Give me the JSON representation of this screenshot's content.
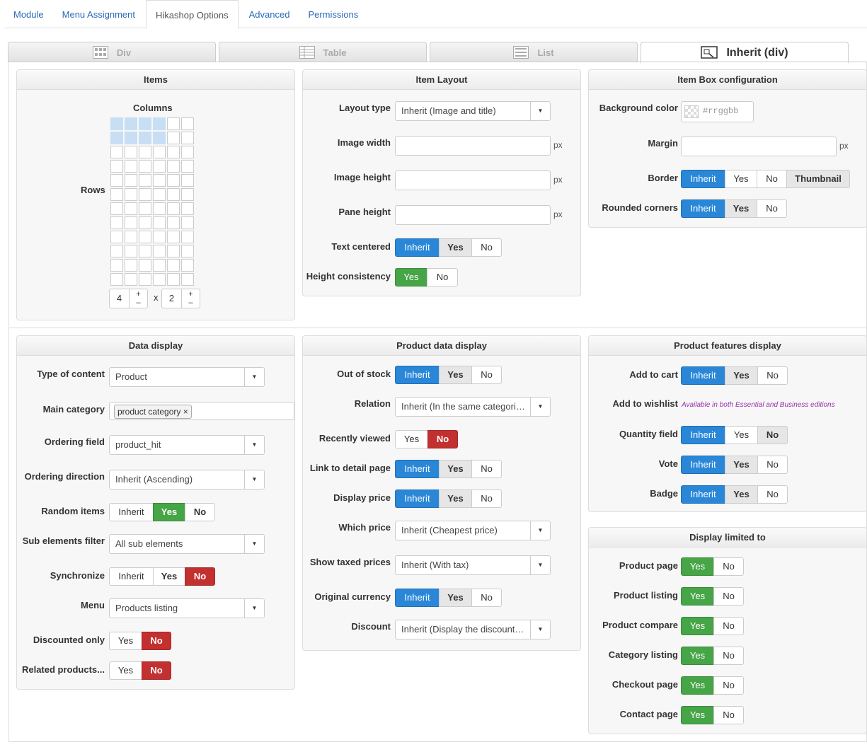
{
  "tabs": [
    "Module",
    "Menu Assignment",
    "Hikashop Options",
    "Advanced",
    "Permissions"
  ],
  "view_tabs": [
    "Div",
    "Table",
    "List",
    "Inherit (div)"
  ],
  "items": {
    "title": "Items",
    "columns_label": "Columns",
    "rows_label": "Rows",
    "columns_value": "4",
    "rows_value": "2",
    "times": "x",
    "plus": "+",
    "minus": "–"
  },
  "item_layout": {
    "title": "Item Layout",
    "layout_type_label": "Layout type",
    "layout_type": "Inherit (Image and title)",
    "image_width_label": "Image width",
    "image_height_label": "Image height",
    "pane_height_label": "Pane height",
    "px": "px",
    "text_centered_label": "Text centered",
    "height_consistency_label": "Height consistency"
  },
  "item_box": {
    "title": "Item Box configuration",
    "bg_color_label": "Background color",
    "bg_color_placeholder": "#rrggbb",
    "margin_label": "Margin",
    "border_label": "Border",
    "rounded_label": "Rounded corners"
  },
  "data_display": {
    "title": "Data display",
    "type_label": "Type of content",
    "type_value": "Product",
    "main_cat_label": "Main category",
    "main_cat_tag": "product category",
    "tag_remove": "×",
    "ordering_field_label": "Ordering field",
    "ordering_field": "product_hit",
    "ordering_dir_label": "Ordering direction",
    "ordering_dir": "Inherit (Ascending)",
    "random_label": "Random items",
    "sub_filter_label": "Sub elements filter",
    "sub_filter": "All sub elements",
    "sync_label": "Synchronize",
    "menu_label": "Menu",
    "menu_value": "Products listing",
    "discounted_label": "Discounted only",
    "related_label": "Related products..."
  },
  "product_data": {
    "title": "Product data display",
    "out_of_stock_label": "Out of stock",
    "relation_label": "Relation",
    "relation_value": "Inherit (In the same categories)",
    "recently_label": "Recently viewed",
    "link_label": "Link to detail page",
    "display_price_label": "Display price",
    "which_price_label": "Which price",
    "which_price": "Inherit (Cheapest price)",
    "taxed_label": "Show taxed prices",
    "taxed_value": "Inherit (With tax)",
    "orig_currency_label": "Original currency",
    "discount_label": "Discount",
    "discount_value": "Inherit (Display the discount amount)"
  },
  "features": {
    "title": "Product features display",
    "cart_label": "Add to cart",
    "wishlist_label": "Add to wishlist",
    "wishlist_note": "Available in both Essential and Business editions",
    "qty_label": "Quantity field",
    "vote_label": "Vote",
    "badge_label": "Badge"
  },
  "limited": {
    "title": "Display limited to",
    "rows": [
      "Product page",
      "Product listing",
      "Product compare",
      "Category listing",
      "Checkout page",
      "Contact page"
    ]
  },
  "opts": {
    "inherit": "Inherit",
    "yes": "Yes",
    "no": "No",
    "thumbnail": "Thumbnail"
  },
  "colors": {
    "blue": "#2a87d8",
    "green": "#46a546",
    "red": "#c23030"
  }
}
